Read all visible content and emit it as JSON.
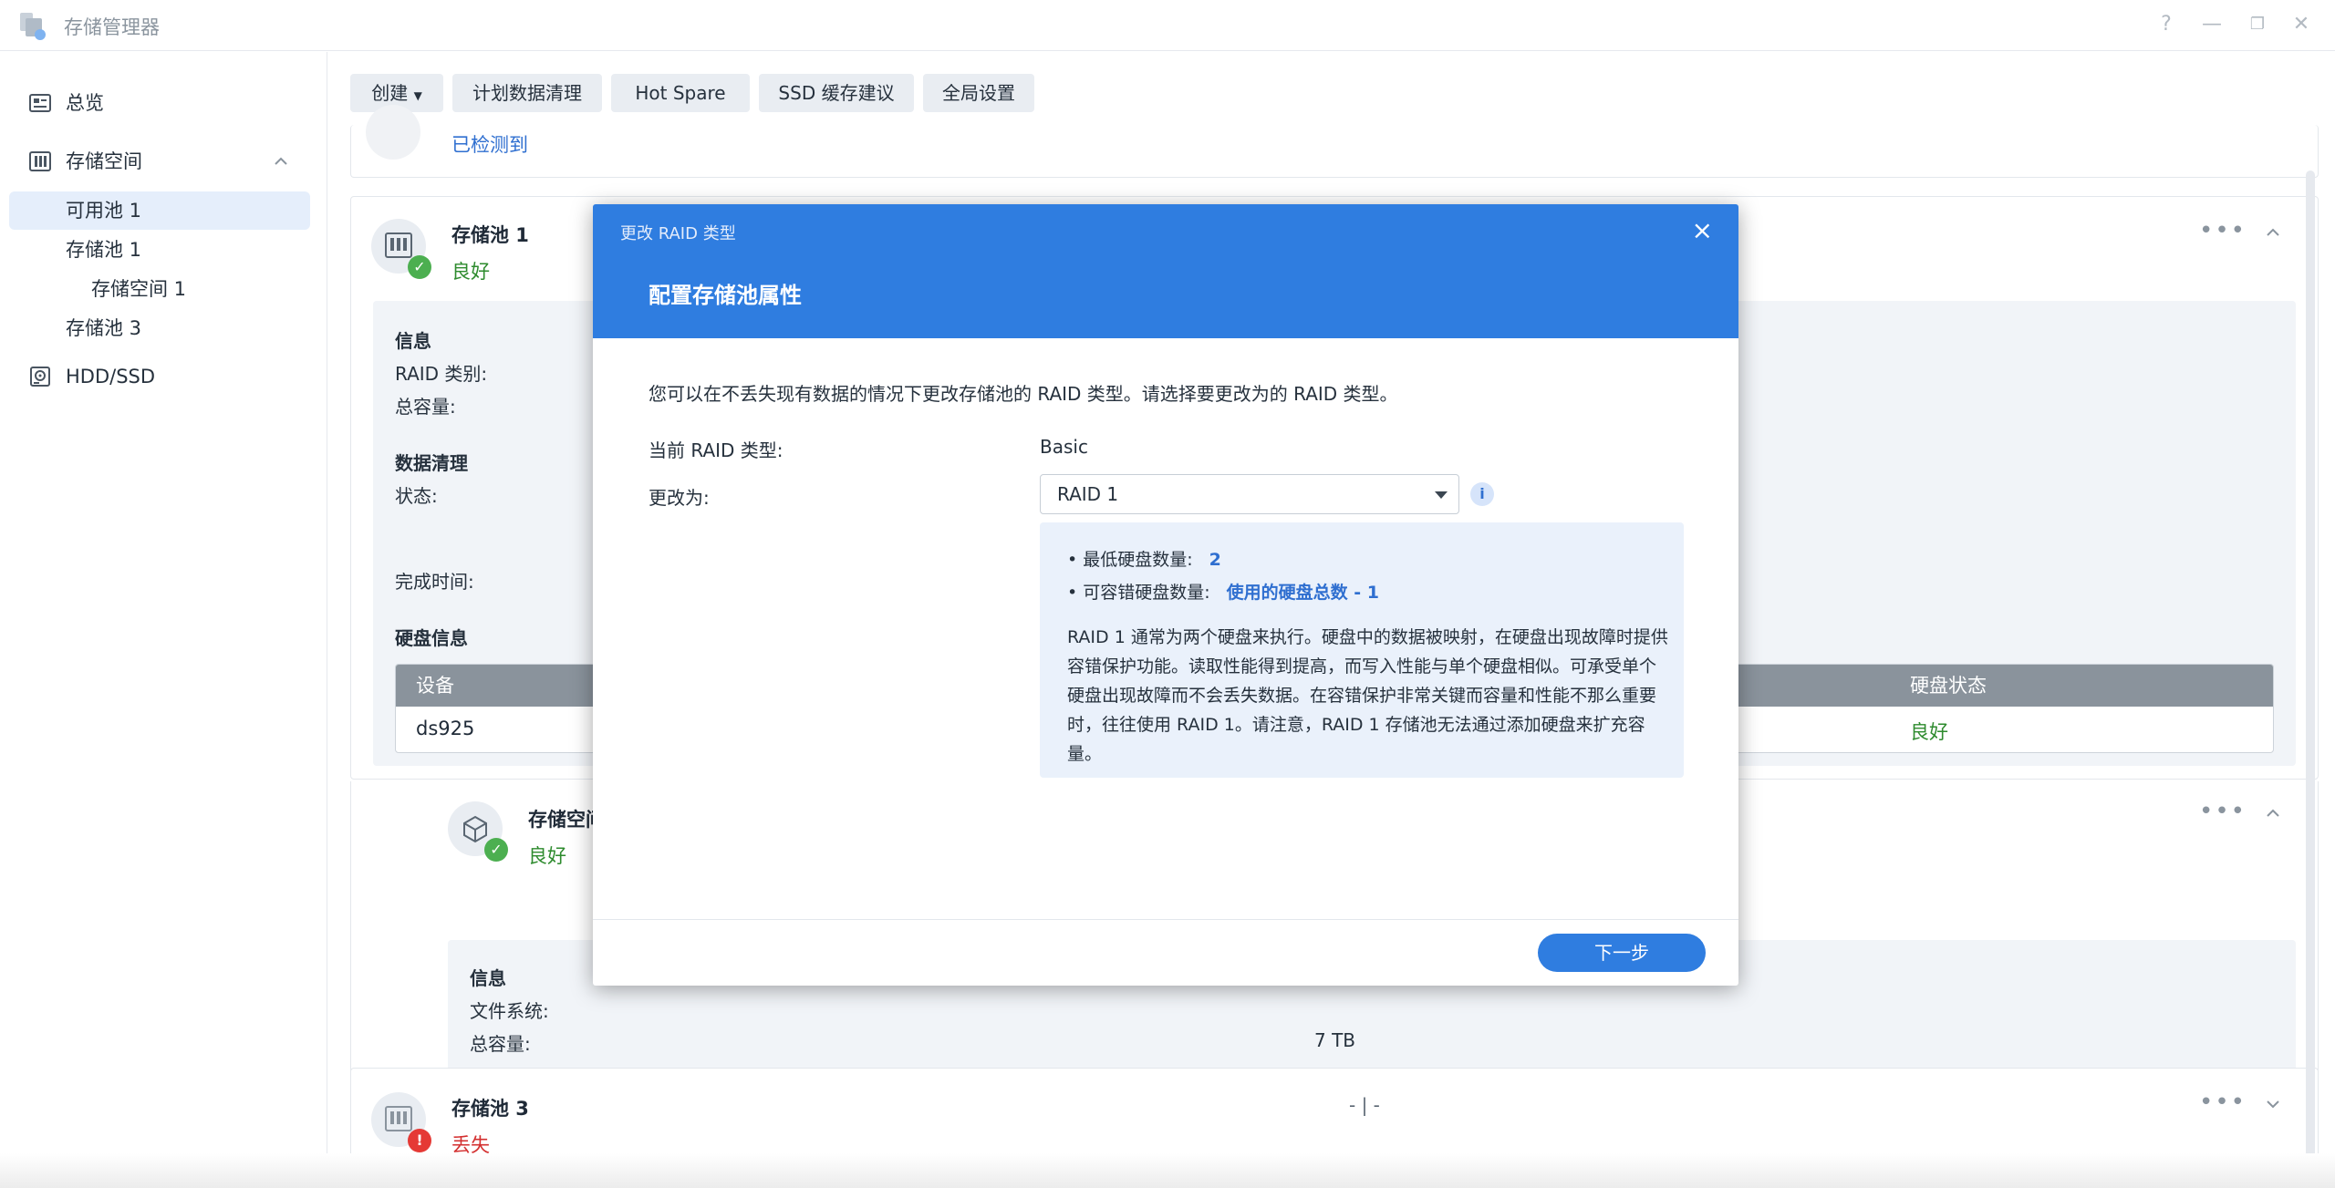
{
  "app": {
    "title": "存储管理器"
  },
  "sidebar": {
    "overview": "总览",
    "storage": "存储空间",
    "sub_items": [
      "可用池 1",
      "存储池 1",
      "存储空间 1",
      "存储池 3"
    ],
    "hdd": "HDD/SSD"
  },
  "toolbar": {
    "create": "创建",
    "scrub": "计划数据清理",
    "hotspare": "Hot Spare",
    "ssd": "SSD 缓存建议",
    "global": "全局设置"
  },
  "top_card": {
    "status": "已检测到"
  },
  "pool1": {
    "title": "存储池 1",
    "status": "良好",
    "info_heading": "信息",
    "raid_label": "RAID 类别:",
    "capacity_label": "总容量:",
    "scrub_heading": "数据清理",
    "state_label": "状态:",
    "finish_label": "完成时间:",
    "disk_heading": "硬盘信息",
    "table_headers": {
      "device": "设备",
      "status": "硬盘状态"
    },
    "row": {
      "device": "ds925",
      "status": "良好"
    }
  },
  "volume1": {
    "title": "存储空间",
    "status": "良好",
    "info_heading": "信息",
    "fs_label": "文件系统:",
    "capacity_label": "总容量:",
    "capacity_value": "7 TB"
  },
  "pool3": {
    "title": "存储池 3",
    "status": "丢失",
    "middle": "- | -"
  },
  "dialog": {
    "title": "更改 RAID 类型",
    "subtitle": "配置存储池属性",
    "desc": "您可以在不丢失现有数据的情况下更改存储池的 RAID 类型。请选择要更改为的 RAID 类型。",
    "current_label": "当前 RAID 类型:",
    "current_value": "Basic",
    "change_label": "更改为:",
    "selected": "RAID 1",
    "min_disks_label": "最低硬盘数量:",
    "min_disks_value": "2",
    "fault_label": "可容错硬盘数量:",
    "fault_value": "使用的硬盘总数 - 1",
    "info_text": "RAID 1 通常为两个硬盘来执行。硬盘中的数据被映射，在硬盘出现故障时提供容错保护功能。读取性能得到提高，而写入性能与单个硬盘相似。可承受单个硬盘出现故障而不会丢失数据。在容错保护非常关键而容量和性能不那么重要时，往往使用 RAID 1。请注意，RAID 1 存储池无法通过添加硬盘来扩充容量。",
    "next": "下一步",
    "close": "×"
  },
  "window": {
    "help": "?",
    "min": "—",
    "max": "❐",
    "close": "✕"
  },
  "colors": {
    "accent": "#2f7de0",
    "ok": "#2e8b2e",
    "error": "#d32f2f"
  }
}
